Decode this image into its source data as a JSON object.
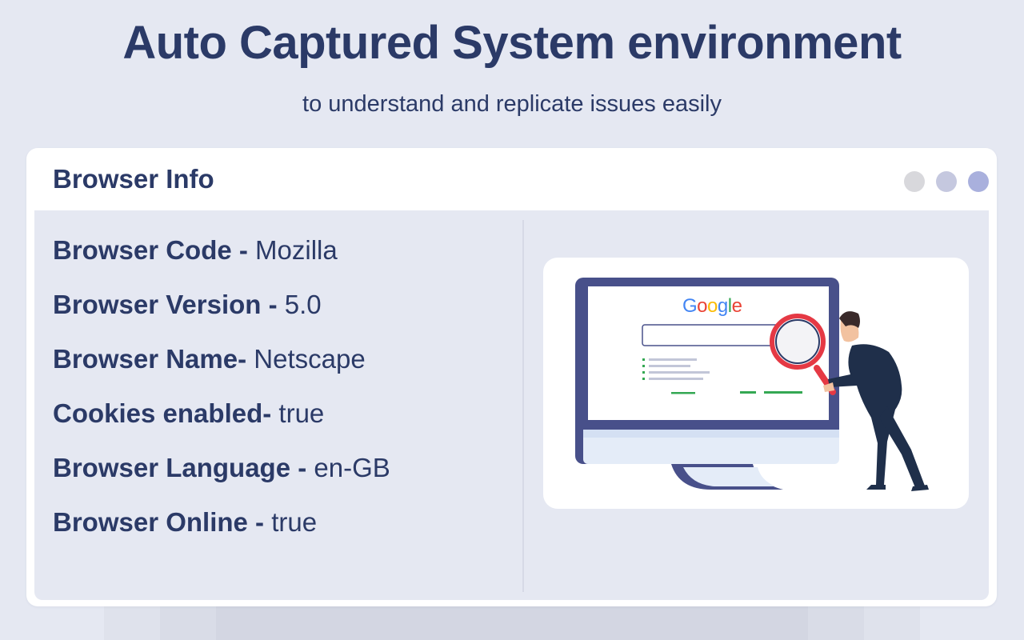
{
  "header": {
    "title": "Auto Captured System environment",
    "subtitle": "to understand and replicate issues easily"
  },
  "window": {
    "title": "Browser Info",
    "controls": [
      {
        "name": "dot-gray",
        "color": "#d8d8dc"
      },
      {
        "name": "dot-light-blue",
        "color": "#c5c8df"
      },
      {
        "name": "dot-blue",
        "color": "#a9b0dd"
      }
    ]
  },
  "browser_info": [
    {
      "label": "Browser Code - ",
      "value": "Mozilla"
    },
    {
      "label": "Browser Version - ",
      "value": "5.0"
    },
    {
      "label": "Browser Name- ",
      "value": "Netscape"
    },
    {
      "label": "Cookies enabled- ",
      "value": "true"
    },
    {
      "label": "Browser Language - ",
      "value": "en-GB"
    },
    {
      "label": "Browser Online - ",
      "value": "true"
    }
  ],
  "illustration": {
    "logo_text": "Google",
    "logo_letters": [
      "G",
      "o",
      "o",
      "g",
      "l",
      "e"
    ],
    "logo_colors": [
      "#4285f4",
      "#ea4335",
      "#fbbc05",
      "#4285f4",
      "#34a853",
      "#ea4335"
    ]
  },
  "colors": {
    "background": "#e5e8f2",
    "heading": "#2b3a67",
    "card": "#ffffff",
    "monitor_frame": "#48508a",
    "magnifier": "#e53944",
    "person_suit": "#1f2f4a"
  }
}
